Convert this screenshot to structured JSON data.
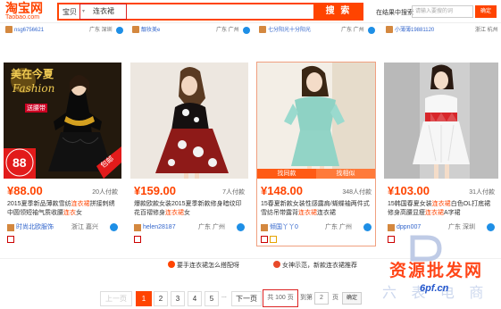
{
  "header": {
    "logo_cn": "淘宝网",
    "logo_en": "Taobao.com",
    "scope": "宝贝",
    "query": "连衣裙",
    "search_button": "搜 索",
    "within_label": "在结果中搜索",
    "within_placeholder": "请输入要搜的词",
    "within_button": "确定"
  },
  "top_row": [
    {
      "seller": "nsg6756621",
      "location": "广东 深圳"
    },
    {
      "seller": "靓妆美e",
      "location": "广东 广州"
    },
    {
      "seller": "七分阳光十分阳光",
      "location": "广东 广州"
    },
    {
      "seller": "小薄薄19881120",
      "location": "浙江 杭州"
    }
  ],
  "products": [
    {
      "price": "¥88.00",
      "paid": "20人付款",
      "title_pre": "2015夏季新品薄款雪纺",
      "title_kw": "连衣裙",
      "title_post": "拼接刺绣中圆领短袖气质收腰",
      "title_kw2": "连衣",
      "title_post2": "女",
      "seller": "时尚北欧服饰",
      "location": "浙江 嘉兴",
      "img_text1": "美在今夏",
      "img_text2": "Fashion",
      "img_text3": "送腰带",
      "img_price": "88",
      "img_tag": "包邮"
    },
    {
      "price": "¥159.00",
      "paid": "7人付款",
      "title_pre": "爆款欧款女装2015夏季新款修身暗纹印花百褶修身",
      "title_kw": "连衣裙",
      "title_post": "女",
      "title_kw2": "",
      "title_post2": "",
      "seller": "helen28187",
      "location": "广东 广州"
    },
    {
      "price": "¥148.00",
      "paid": "348人付款",
      "title_pre": "15春夏新款女装性感露肩/蝴蝶袖两件式雪纺吊带露背",
      "title_kw": "连衣裙",
      "title_post": "连衣裙",
      "title_kw2": "",
      "title_post2": "",
      "seller": "倾国丫丫0",
      "location": "广东 广州",
      "img_tag1": "找同款",
      "img_tag2": "找相似"
    },
    {
      "price": "¥103.00",
      "paid": "31人付款",
      "title_pre": "15韩国春夏女装",
      "title_kw": "连衣裙",
      "title_post": "白色OL打底裙修身高腰显瘦",
      "title_kw2": "连衣裙",
      "title_post2": "A字裙",
      "seller": "dppn007",
      "location": "广东 深圳"
    }
  ],
  "bottom_notices": {
    "left": "要手连衣裙怎么搭配呀",
    "right": "女神示范，新款连衣裙推荐"
  },
  "pager": {
    "prev": "上一页",
    "pages": [
      "1",
      "2",
      "3",
      "4",
      "5"
    ],
    "ellipsis": "...",
    "next": "下一页",
    "total": "共 100 页",
    "goto_label": "到第",
    "goto_value": "2",
    "page_unit": "页",
    "ok": "确定"
  },
  "watermark": {
    "line1": "资源批发网",
    "line2": "6pf.cn",
    "line3": "六 表 电 商"
  },
  "colors": {
    "accent": "#ff4400",
    "link": "#3366cc"
  }
}
